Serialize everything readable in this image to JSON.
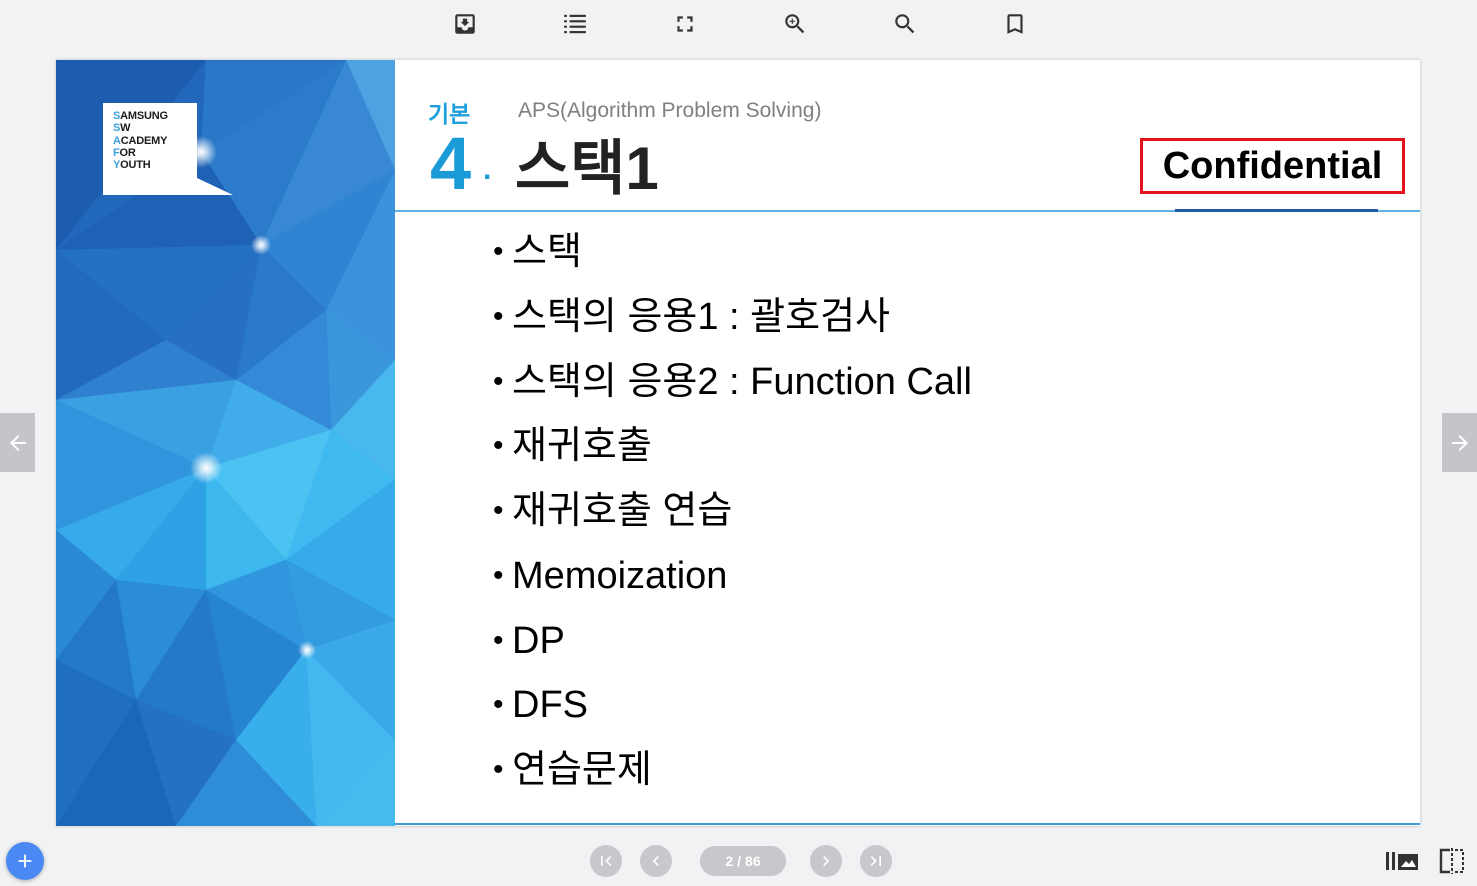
{
  "theme": {
    "page_background": "#f1f2f4",
    "accent_blue": "#1a9ad6",
    "stamp_red": "#e3131b",
    "fab_blue": "#4a89f3",
    "control_gray": "#c5c7ca"
  },
  "toolbar": {
    "icons": [
      "download-icon",
      "list-icon",
      "fullscreen-icon",
      "zoom-in-icon",
      "search-icon",
      "bookmark-icon"
    ]
  },
  "slide": {
    "logo": {
      "lines": [
        {
          "initial": "S",
          "rest": "AMSUNG"
        },
        {
          "initial": "S",
          "rest": "W"
        },
        {
          "initial": "A",
          "rest": "CADEMY"
        },
        {
          "initial": "F",
          "rest": "OR"
        },
        {
          "initial": "Y",
          "rest": "OUTH"
        }
      ]
    },
    "header": {
      "category": "기본",
      "subtitle": "APS(Algorithm Problem Solving)",
      "number": "4",
      "number_dot": ".",
      "title": "스택1",
      "stamp": "Confidential"
    },
    "bullet": "•",
    "items": [
      "스택",
      "스택의 응용1 : 괄호검사",
      "스택의 응용2 : Function Call",
      "재귀호출",
      "재귀호출 연습",
      "Memoization",
      "DP",
      "DFS",
      "연습문제"
    ]
  },
  "side_nav": {
    "prev_icon": "arrow-left-icon",
    "next_icon": "arrow-right-icon"
  },
  "pager": {
    "first_icon": "first-page-icon",
    "prev_icon": "chevron-left-icon",
    "current": "2",
    "separator": "/",
    "total": "86",
    "next_icon": "chevron-right-icon",
    "last_icon": "last-page-icon"
  },
  "fab": {
    "icon": "plus-icon"
  },
  "view_controls": {
    "icons": [
      "library-icon",
      "split-view-icon"
    ]
  }
}
